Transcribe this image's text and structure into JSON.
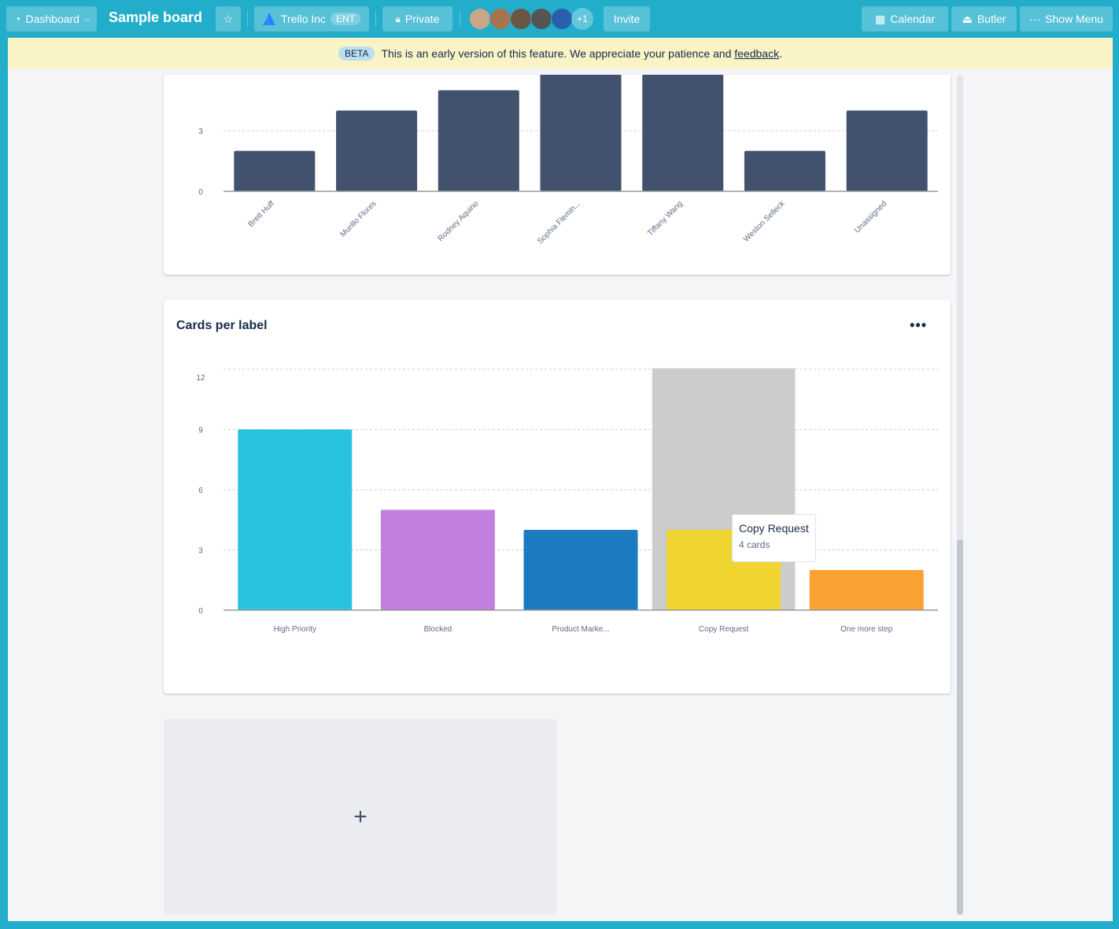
{
  "topbar": {
    "dashboard": "Dashboard",
    "board_title": "Sample board",
    "workspace": "Trello Inc",
    "workspace_badge": "ENT",
    "visibility": "Private",
    "extra_members": "+1",
    "invite": "Invite",
    "calendar": "Calendar",
    "butler": "Butler",
    "show_menu": "Show Menu"
  },
  "banner": {
    "badge": "BETA",
    "text": "This is an early version of this feature. We appreciate your patience and",
    "link": "feedback",
    "end": "."
  },
  "cards_per_member": {
    "more": "•••"
  },
  "cards_per_label": {
    "title": "Cards per label",
    "more": "•••",
    "tooltip": {
      "label": "Copy Request",
      "value": "4 cards"
    }
  },
  "add_card": {
    "icon": "plus-icon",
    "label": "+"
  },
  "chart_data": [
    {
      "type": "bar",
      "title": "",
      "categories": [
        "Brett Huff",
        "Murillo Flores",
        "Rodney Aquino",
        "Sophia Flemin...",
        "Tiffany Wang",
        "Weston Selleck",
        "Unassigned"
      ],
      "values": [
        2,
        4,
        5,
        6,
        6,
        2,
        4
      ],
      "yticks": [
        0,
        3
      ],
      "color": "#42526e",
      "grid": true,
      "note_visible_clipped": true
    },
    {
      "type": "bar",
      "title": "Cards per label",
      "categories": [
        "High Priority",
        "Blocked",
        "Product Marke...",
        "Copy Request",
        "One more step"
      ],
      "values": [
        9,
        5,
        4,
        4,
        2
      ],
      "colors": [
        "#29c2e0",
        "#c27fdf",
        "#1b7ac0",
        "#f0d42f",
        "#fca233"
      ],
      "yticks": [
        0,
        3,
        6,
        9,
        12
      ],
      "ylim": [
        0,
        12
      ],
      "grid": true,
      "highlighted": "Copy Request"
    }
  ]
}
